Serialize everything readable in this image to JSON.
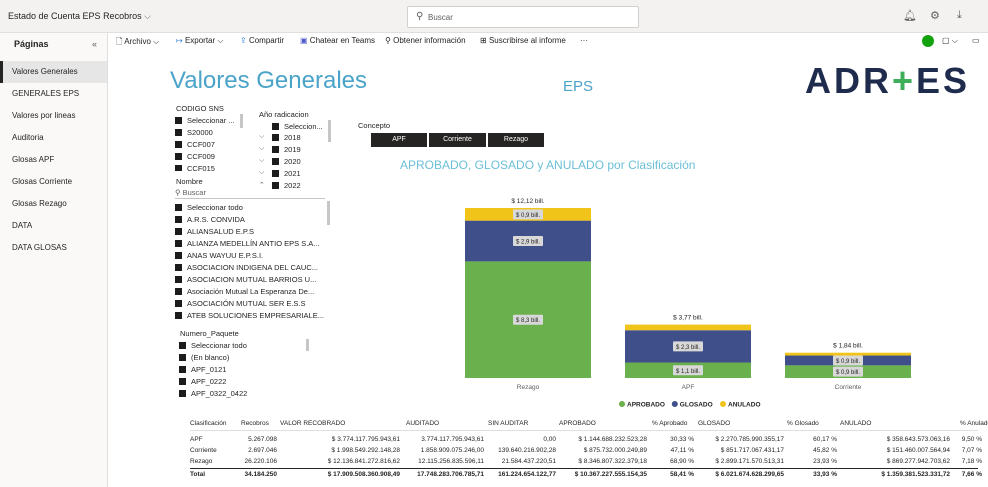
{
  "topbar": {
    "report_title": "Estado de Cuenta EPS Recobros",
    "search_placeholder": "Buscar"
  },
  "toolbar": {
    "archivo": "Archivo",
    "exportar": "Exportar",
    "compartir": "Compartir",
    "chatear": "Chatear en Teams",
    "obtener": "Obtener información",
    "suscribirse": "Suscribirse al informe",
    "more": "···"
  },
  "pages": {
    "title": "Páginas",
    "items": [
      "Valores Generales",
      "GENERALES EPS",
      "Valores por lineas",
      "Auditoria",
      "Glosas APF",
      "Glosas Corriente",
      "Glosas Rezago",
      "DATA",
      "DATA GLOSAS"
    ]
  },
  "header": {
    "title": "Valores Generales",
    "eps": "EPS",
    "logo_left": "ADR",
    "logo_plus": "+",
    "logo_right": "ES"
  },
  "slicers": {
    "codigo_sns": {
      "title": "CODIGO SNS",
      "options": [
        "Seleccionar ...",
        "S20000",
        "CCF007",
        "CCF009",
        "CCF015"
      ]
    },
    "ano_radicacion": {
      "title": "Año radicacion",
      "options": [
        "Seleccion...",
        "2018",
        "2019",
        "2020",
        "2021",
        "2022"
      ]
    },
    "nombre": {
      "title": "Nombre",
      "search": "Buscar",
      "options": [
        "Seleccionar todo",
        "A.R.S. CONVIDA",
        "ALIANSALUD E.P.S",
        "ALIANZA MEDELLÍN ANTIO EPS S.A...",
        "ANAS WAYUU E.P.S.I.",
        "ASOCIACION INDIGENA DEL CAUC...",
        "ASOCIACION MUTUAL BARRIOS U...",
        "Asociación Mutual La Esperanza De...",
        "ASOCIACIÓN MUTUAL SER E.S.S",
        "ATEB SOLUCIONES EMPRESARIALE..."
      ]
    },
    "numero_paquete": {
      "title": "Numero_Paquete",
      "options": [
        "Seleccionar todo",
        "(En blanco)",
        "APF_0121",
        "APF_0222",
        "APF_0322_0422"
      ]
    },
    "concepto": {
      "title": "Concepto",
      "buttons": [
        "APF",
        "Corriente",
        "Rezago"
      ]
    }
  },
  "chart_data": {
    "type": "bar",
    "stacked": true,
    "title": "APROBADO, GLOSADO y ANULADO por Clasificación",
    "categories": [
      "Rezago",
      "APF",
      "Corriente"
    ],
    "series": [
      {
        "name": "APROBADO",
        "color": "#6ab04c",
        "values": [
          8.3,
          1.1,
          0.9
        ],
        "labels": [
          "$ 8,3 bill.",
          "$ 1,1 bill.",
          "$ 0,9 bill."
        ]
      },
      {
        "name": "GLOSADO",
        "color": "#3f4f8a",
        "values": [
          2.9,
          2.3,
          0.7
        ],
        "labels": [
          "$ 2,9 bill.",
          "$ 2,3 bill.",
          "$ 0,9 bill."
        ]
      },
      {
        "name": "ANULADO",
        "color": "#f0c419",
        "values": [
          0.9,
          0.4,
          0.2
        ],
        "labels": [
          "$ 0,9 bill.",
          "",
          ""
        ]
      }
    ],
    "totals": [
      "$ 12,12 bill.",
      "$ 3,77 bill.",
      "$ 1,84 bill."
    ],
    "legend_position": "bottom"
  },
  "table": {
    "headers": [
      "Clasificación",
      "Recobros",
      "VALOR RECOBRADO",
      "AUDITADO",
      "SIN AUDITAR",
      "APROBADO",
      "% Aprobado",
      "GLOSADO",
      "% Glosado",
      "ANULADO",
      "% Anulado"
    ],
    "rows": [
      [
        "APF",
        "5.267.098",
        "$ 3.774.117.795.943,61",
        "3.774.117.795.943,61",
        "0,00",
        "$ 1.144.688.232.523,28",
        "30,33 %",
        "$ 2.270.785.990.355,17",
        "60,17 %",
        "$ 358.643.573.063,16",
        "9,50 %"
      ],
      [
        "Corriente",
        "2.697.046",
        "$ 1.998.549.292.148,28",
        "1.858.909.075.246,00",
        "139.640.216.902,28",
        "$ 875.732.000.249,89",
        "47,11 %",
        "$ 851.717.067.431,17",
        "45,82 %",
        "$ 151.460.007.564,94",
        "7,07 %"
      ],
      [
        "Rezago",
        "26.220.106",
        "$ 12.136.841.272.816,62",
        "12.115.256.835.596,11",
        "21.584.437.220,51",
        "$ 8.346.807.322.379,18",
        "68,90 %",
        "$ 2.899.171.570.513,31",
        "23,93 %",
        "$ 869.277.942.703,62",
        "7,18 %"
      ]
    ],
    "total": [
      "Total",
      "34.184.250",
      "$ 17.909.508.360.908,49",
      "17.748.283.706.785,71",
      "161.224.654.122,77",
      "$ 10.367.227.555.154,35",
      "58,41 %",
      "$ 6.021.674.628.299,65",
      "33,93 %",
      "$ 1.359.381.523.331,72",
      "7,66 %"
    ]
  }
}
